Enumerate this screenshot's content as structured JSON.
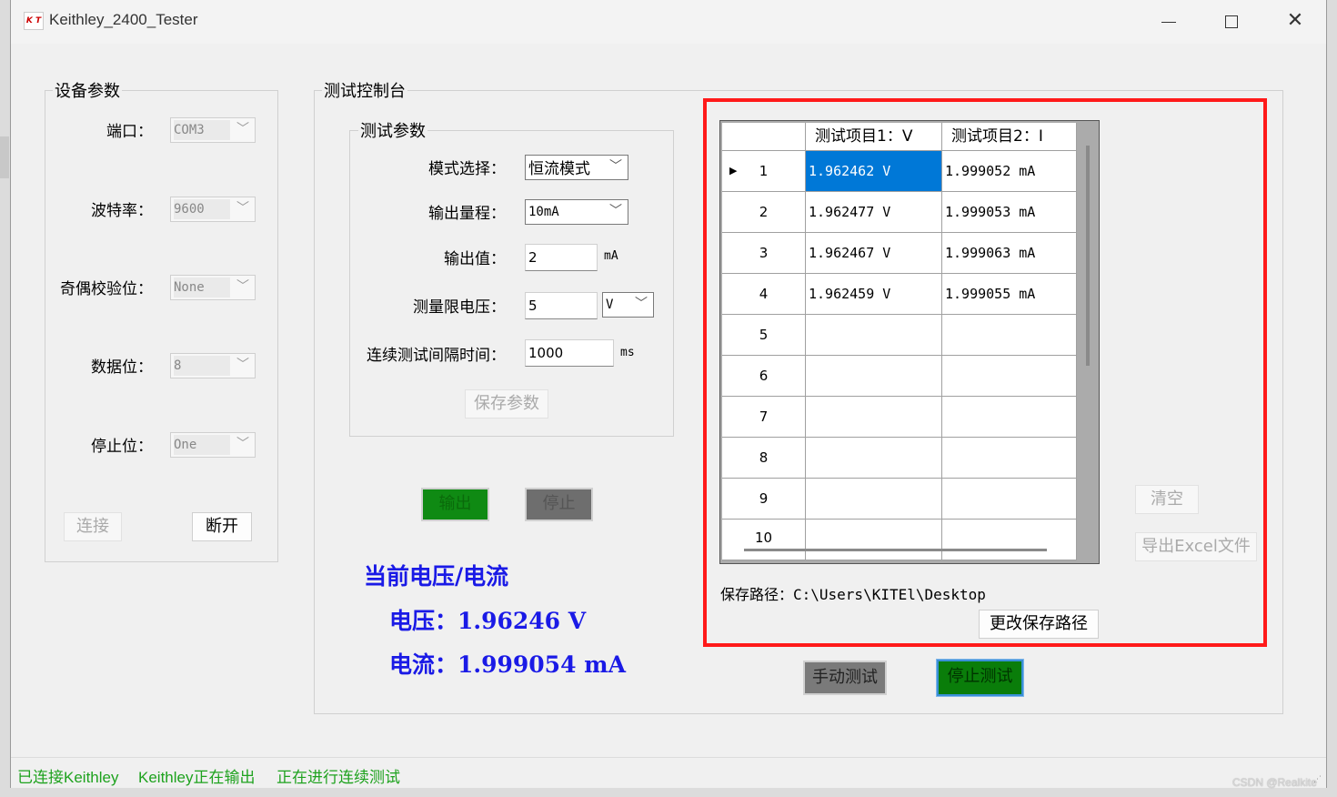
{
  "window": {
    "title": "Keithley_2400_Tester",
    "icon_text": "K T"
  },
  "device_params": {
    "title": "设备参数",
    "port_label": "端口：",
    "port_value": "COM3",
    "baud_label": "波特率：",
    "baud_value": "9600",
    "parity_label": "奇偶校验位：",
    "parity_value": "None",
    "databits_label": "数据位：",
    "databits_value": "8",
    "stopbits_label": "停止位：",
    "stopbits_value": "One",
    "connect_label": "连接",
    "disconnect_label": "断开"
  },
  "console": {
    "title": "测试控制台",
    "params_title": "测试参数",
    "mode_label": "模式选择：",
    "mode_value": "恒流模式",
    "range_label": "输出量程：",
    "range_value": "10mA",
    "output_label": "输出值：",
    "output_value": "2",
    "output_unit": "mA",
    "limit_label": "测量限电压：",
    "limit_value": "5",
    "limit_unit_value": "V",
    "interval_label": "连续测试间隔时间：",
    "interval_value": "1000",
    "interval_unit": "ms",
    "save_params_label": "保存参数",
    "output_button_label": "输出",
    "stop_button_label": "停止",
    "readout_title": "当前电压/电流",
    "voltage_readout": "电压：1.96246 V",
    "current_readout": "电流：1.999054 mA",
    "manual_test_label": "手动测试",
    "stop_test_label": "停止测试"
  },
  "results": {
    "columns": [
      "测试项目1：V",
      "测试项目2：I"
    ],
    "rows": [
      {
        "num": "1",
        "v": "1.962462 V",
        "i": "1.999052 mA"
      },
      {
        "num": "2",
        "v": "1.962477 V",
        "i": "1.999053 mA"
      },
      {
        "num": "3",
        "v": "1.962467 V",
        "i": "1.999063 mA"
      },
      {
        "num": "4",
        "v": "1.962459 V",
        "i": "1.999055 mA"
      },
      {
        "num": "5",
        "v": "",
        "i": ""
      },
      {
        "num": "6",
        "v": "",
        "i": ""
      },
      {
        "num": "7",
        "v": "",
        "i": ""
      },
      {
        "num": "8",
        "v": "",
        "i": ""
      },
      {
        "num": "9",
        "v": "",
        "i": ""
      },
      {
        "num": "10",
        "v": "",
        "i": ""
      }
    ],
    "save_path_label": "保存路径：C:\\Users\\KITEl\\Desktop",
    "change_path_label": "更改保存路径",
    "clear_label": "清空",
    "export_label": "导出Excel文件"
  },
  "status": {
    "connected": "已连接Keithley",
    "outputting": "Keithley正在输出",
    "testing": "正在进行连续测试"
  },
  "watermark": "CSDN @Realkite",
  "colors": {
    "accent_red": "#ff1a1a",
    "readout_blue": "#1a1ae6",
    "status_green": "#1ea21e",
    "button_green": "#0f8a13",
    "selection_blue": "#0078d7"
  }
}
